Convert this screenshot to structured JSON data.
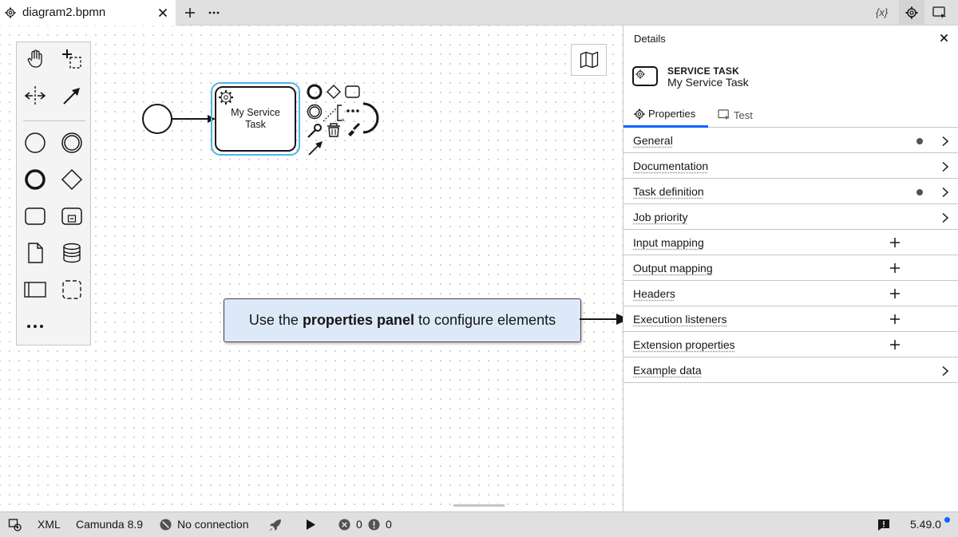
{
  "tab": {
    "title": "diagram2.bpmn",
    "icon": "gear-icon"
  },
  "toolbar": {
    "variables_label": "{x}"
  },
  "canvas": {
    "service_task_label_line1": "My Service",
    "service_task_label_line2": "Task",
    "callout": {
      "prefix": "Use the",
      "bold": "properties panel",
      "suffix": "to configure elements"
    }
  },
  "panel": {
    "title": "Details",
    "element_type": "SERVICE TASK",
    "element_name": "My Service Task",
    "tabs": [
      {
        "label": "Properties",
        "active": true
      },
      {
        "label": "Test",
        "active": false
      }
    ],
    "groups": [
      {
        "label": "General",
        "indicator": true,
        "action": "expand"
      },
      {
        "label": "Documentation",
        "indicator": false,
        "action": "expand"
      },
      {
        "label": "Task definition",
        "indicator": true,
        "action": "expand"
      },
      {
        "label": "Job priority",
        "indicator": false,
        "action": "expand"
      },
      {
        "label": "Input mapping",
        "indicator": false,
        "action": "add"
      },
      {
        "label": "Output mapping",
        "indicator": false,
        "action": "add"
      },
      {
        "label": "Headers",
        "indicator": false,
        "action": "add"
      },
      {
        "label": "Execution listeners",
        "indicator": false,
        "action": "add"
      },
      {
        "label": "Extension properties",
        "indicator": false,
        "action": "add"
      },
      {
        "label": "Example data",
        "indicator": false,
        "action": "expand"
      }
    ]
  },
  "statusbar": {
    "xml_label": "XML",
    "engine_label": "Camunda 8.9",
    "connection_label": "No connection",
    "errors_count": "0",
    "warnings_count": "0",
    "version_label": "5.49.0"
  },
  "colors": {
    "accent": "#0f62fe",
    "selection": "#4eb4e8",
    "callout_bg": "#dde9f8",
    "chrome_bg": "#e0e0e0",
    "version_dot": "#0f62fe"
  }
}
